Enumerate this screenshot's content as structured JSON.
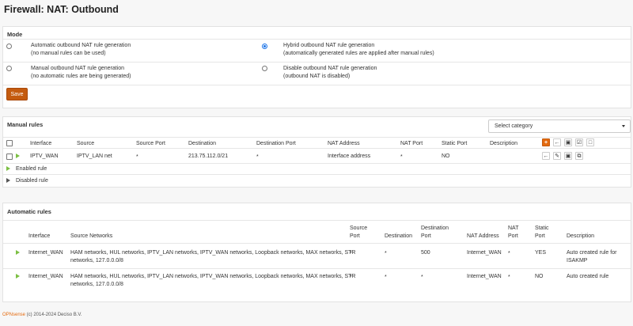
{
  "page": {
    "title": "Firewall: NAT: Outbound"
  },
  "mode": {
    "heading": "Mode",
    "options": [
      {
        "label": "Automatic outbound NAT rule generation",
        "sub": "(no manual rules can be used)",
        "selected": false
      },
      {
        "label": "Hybrid outbound NAT rule generation",
        "sub": "(automatically generated rules are applied after manual rules)",
        "selected": true
      },
      {
        "label": "Manual outbound NAT rule generation",
        "sub": "(no automatic rules are being generated)",
        "selected": false
      },
      {
        "label": "Disable outbound NAT rule generation",
        "sub": "(outbound NAT is disabled)",
        "selected": false
      }
    ],
    "save_label": "Save"
  },
  "manual": {
    "heading": "Manual rules",
    "category_placeholder": "Select category",
    "columns": [
      "Interface",
      "Source",
      "Source Port",
      "Destination",
      "Destination Port",
      "NAT Address",
      "NAT Port",
      "Static Port",
      "Description"
    ],
    "rows": [
      {
        "interface": "IPTV_WAN",
        "source": "IPTV_LAN net",
        "source_port": "*",
        "destination": "213.75.112.0/21",
        "destination_port": "*",
        "nat_address": "Interface address",
        "nat_port": "*",
        "static_port": "NO",
        "description": ""
      }
    ],
    "legend": {
      "enabled": "Enabled rule",
      "disabled": "Disabled rule"
    }
  },
  "automatic": {
    "heading": "Automatic rules",
    "columns": {
      "interface": "Interface",
      "source_networks": "Source Networks",
      "source_port_1": "Source",
      "source_port_2": "Port",
      "destination": "Destination",
      "destination_port_1": "Destination",
      "destination_port_2": "Port",
      "nat_address": "NAT Address",
      "nat_port_1": "NAT",
      "nat_port_2": "Port",
      "static_port_1": "Static",
      "static_port_2": "Port",
      "description": "Description"
    },
    "rows": [
      {
        "interface": "Internet_WAN",
        "networks_1": "HAM networks, HUL networks, IPTV_LAN networks, IPTV_WAN networks, Loopback networks, MAX networks, STR",
        "networks_2": "networks, 127.0.0.0/8",
        "source_port": "*",
        "destination": "*",
        "destination_port": "500",
        "nat_address": "Internet_WAN",
        "nat_port": "*",
        "static_port": "YES",
        "description_1": "Auto created rule for",
        "description_2": "ISAKMP"
      },
      {
        "interface": "Internet_WAN",
        "networks_1": "HAM networks, HUL networks, IPTV_LAN networks, IPTV_WAN networks, Loopback networks, MAX networks, STR",
        "networks_2": "networks, 127.0.0.0/8",
        "source_port": "*",
        "destination": "*",
        "destination_port": "*",
        "nat_address": "Internet_WAN",
        "nat_port": "*",
        "static_port": "NO",
        "description_1": "Auto created rule",
        "description_2": ""
      }
    ]
  },
  "footer": {
    "brand": "OPNsense",
    "copyright": " (c) 2014-2024 ",
    "company": "Deciso B.V."
  },
  "colors": {
    "accent": "#e46b10",
    "save": "#c45b0f",
    "enabled": "#7cbf43",
    "radio": "#1a73e8"
  },
  "icons": {
    "add": "plus-icon",
    "back": "arrow-left-icon",
    "delete": "trash-icon",
    "toggle": "check-square-icon",
    "select": "square-icon",
    "edit": "pencil-icon",
    "clone": "copy-icon"
  }
}
